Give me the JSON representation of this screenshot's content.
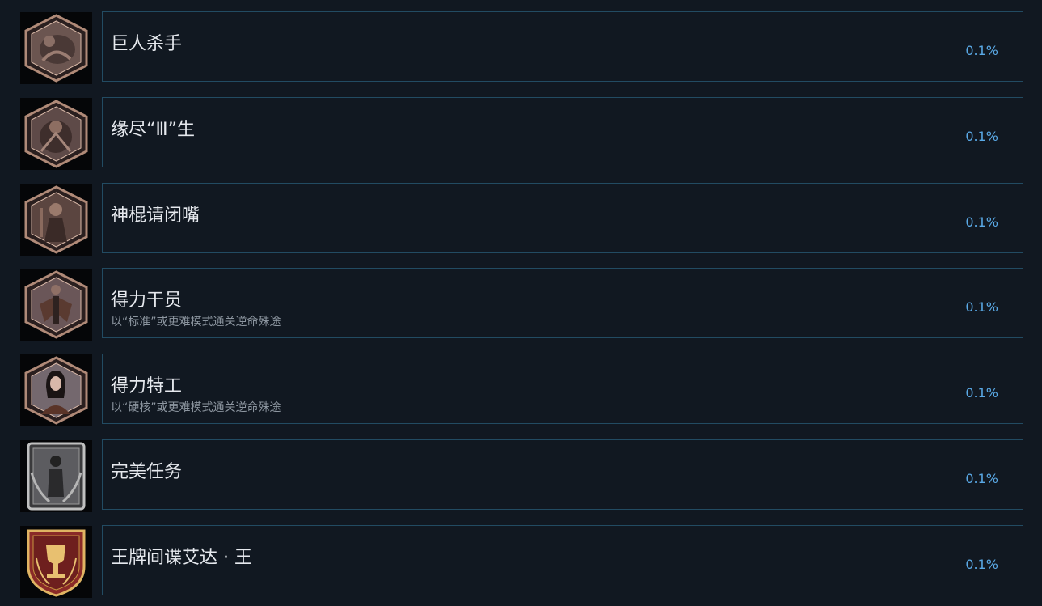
{
  "achievements": [
    {
      "title": "巨人杀手",
      "description": "",
      "percent": "0.1%",
      "icon": "hexagon-giant-creature-icon"
    },
    {
      "title": "缘尽“Ⅲ”生",
      "description": "",
      "percent": "0.1%",
      "icon": "hexagon-creature-icon"
    },
    {
      "title": "神棍请闭嘴",
      "description": "",
      "percent": "0.1%",
      "icon": "hexagon-robed-figure-icon"
    },
    {
      "title": "得力干员",
      "description": "以“标准”或更难模式通关逆命殊途",
      "percent": "0.1%",
      "icon": "hexagon-winged-figure-icon"
    },
    {
      "title": "得力特工",
      "description": "以“硬核”或更难模式通关逆命殊途",
      "percent": "0.1%",
      "icon": "hexagon-agent-portrait-icon"
    },
    {
      "title": "完美任务",
      "description": "",
      "percent": "0.1%",
      "icon": "laurel-frame-agent-icon"
    },
    {
      "title": "王牌间谍艾达 · 王",
      "description": "",
      "percent": "0.1%",
      "icon": "gold-trophy-shield-icon"
    }
  ]
}
